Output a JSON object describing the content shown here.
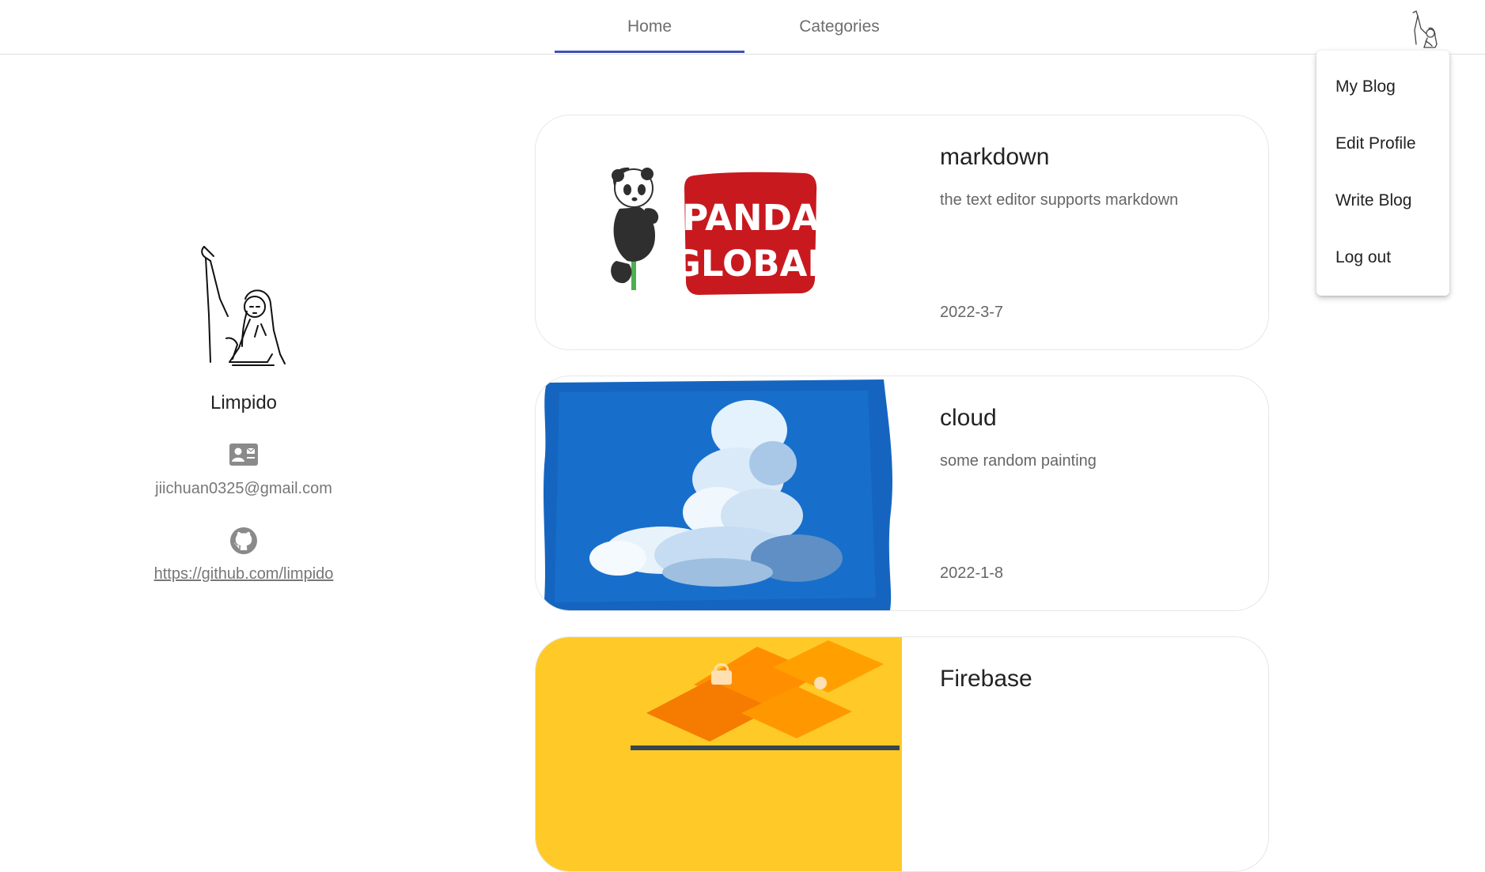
{
  "nav": {
    "tabs": [
      {
        "label": "Home",
        "active": true
      },
      {
        "label": "Categories",
        "active": false
      }
    ],
    "accent_color": "#3f51b5"
  },
  "menu": {
    "items": [
      {
        "label": "My Blog"
      },
      {
        "label": "Edit Profile"
      },
      {
        "label": "Write Blog"
      },
      {
        "label": "Log out"
      }
    ]
  },
  "profile": {
    "name": "Limpido",
    "email": "jiichuan0325@gmail.com",
    "github": "https://github.com/limpido",
    "icons": [
      "contact-card-icon",
      "github-icon"
    ]
  },
  "posts": [
    {
      "title": "markdown",
      "description": "the text editor supports markdown",
      "date": "2022-3-7",
      "image": "panda-global-logo",
      "logo_text": [
        "PANDA",
        "GLOBAL"
      ]
    },
    {
      "title": "cloud",
      "description": "some random painting",
      "date": "2022-1-8",
      "image": "cloud-painting"
    },
    {
      "title": "Firebase",
      "description": "",
      "date": "",
      "image": "firebase-illustration"
    }
  ]
}
